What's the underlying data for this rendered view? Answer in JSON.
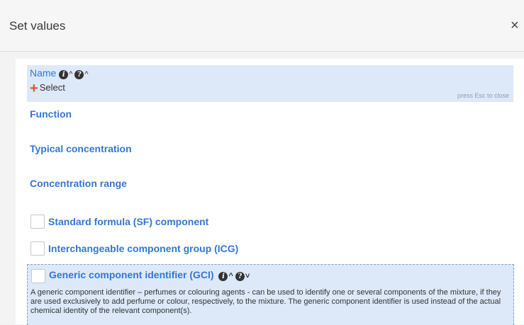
{
  "dialog": {
    "title": "Set values",
    "close_glyph": "×"
  },
  "name_field": {
    "label": "Name",
    "info_glyph": "i",
    "help_glyph": "?",
    "caret_up": "^",
    "select_plus": "+",
    "select_label": "Select",
    "esc_hint": "press Esc to close"
  },
  "fields": {
    "function": "Function",
    "typical_concentration": "Typical concentration",
    "concentration_range": "Concentration range"
  },
  "checkboxes": {
    "sf": "Standard formula (SF) component",
    "icg": "Interchangeable component group (ICG)",
    "gci": "Generic component identifier (GCI)"
  },
  "gci": {
    "caret_up": "^",
    "caret_down": "˅",
    "description": "A generic component identifier – perfumes or colouring agents - can be used to identify one or several components of the mixture, if they are used exclusively to add perfume or colour, respectively, to the mixture. The generic component identifier is used instead of the actual chemical identity of the relevant component(s)."
  },
  "colors": {
    "accent": "#3277d5",
    "highlight": "#dde9f9",
    "plus": "#e2522e"
  }
}
